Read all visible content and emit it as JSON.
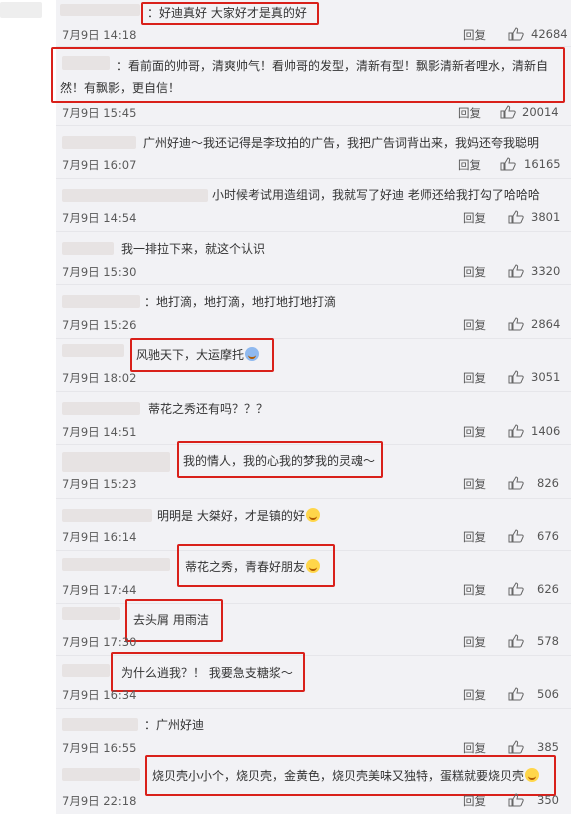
{
  "comments": [
    {
      "text": "：好迪真好 大家好才是真的好",
      "time": "7月9日 14:18",
      "likes": "42684"
    },
    {
      "text": "：看前面的帅哥，清爽帅气！看帅哥的发型，清新有型！飘影清新者哩水，清新自然！有飘影，更自信！",
      "time": "7月9日 15:45",
      "likes": "20014"
    },
    {
      "text": "广州好迪～我还记得是李玟拍的广告，我把广告词背出来，我妈还夸我聪明",
      "time": "7月9日 16:07",
      "likes": "16165"
    },
    {
      "text": "小时候考试用造组词，我就写了好迪 老师还给我打勾了哈哈哈",
      "time": "7月9日 14:54",
      "likes": "3801"
    },
    {
      "text": "我一排拉下来，就这个认识",
      "time": "7月9日 15:30",
      "likes": "3320"
    },
    {
      "text": "：地打滴，地打滴，地打地打地打滴",
      "time": "7月9日 15:26",
      "likes": "2864"
    },
    {
      "text": "风驰天下，大运摩托",
      "time": "7月9日 18:02",
      "likes": "3051"
    },
    {
      "text": "蒂花之秀还有吗？？？",
      "time": "7月9日 14:51",
      "likes": "1406"
    },
    {
      "text": "我的情人，我的心我的梦我的灵魂～",
      "time": "7月9日 15:23",
      "likes": "826"
    },
    {
      "text": "明明是 大桀好，才是镇的好",
      "time": "7月9日 16:14",
      "likes": "676"
    },
    {
      "text": "蒂花之秀，青春好朋友",
      "time": "7月9日 17:44",
      "likes": "626"
    },
    {
      "text": "去头屑 用雨洁",
      "time": "7月9日 17:30",
      "likes": "578"
    },
    {
      "text": "为什么逍我？！ 我要急支糖浆～",
      "time": "7月9日 16:34",
      "likes": "506"
    },
    {
      "text": "：广州好迪",
      "time": "7月9日 16:55",
      "likes": "385"
    },
    {
      "text": "烧贝壳小小个，烧贝壳，金黄色，烧贝壳美味又独特，蛋糕就要烧贝壳",
      "time": "7月9日 22:18",
      "likes": "350"
    }
  ],
  "reply_label": "回复",
  "icons": {
    "like": "thumbs-up-icon",
    "emoji": "laughing-emoji-icon"
  },
  "colors": {
    "highlight": "#d9201a",
    "panel": "#f2f2f5",
    "text": "#333333",
    "meta": "#5a5a5a"
  }
}
